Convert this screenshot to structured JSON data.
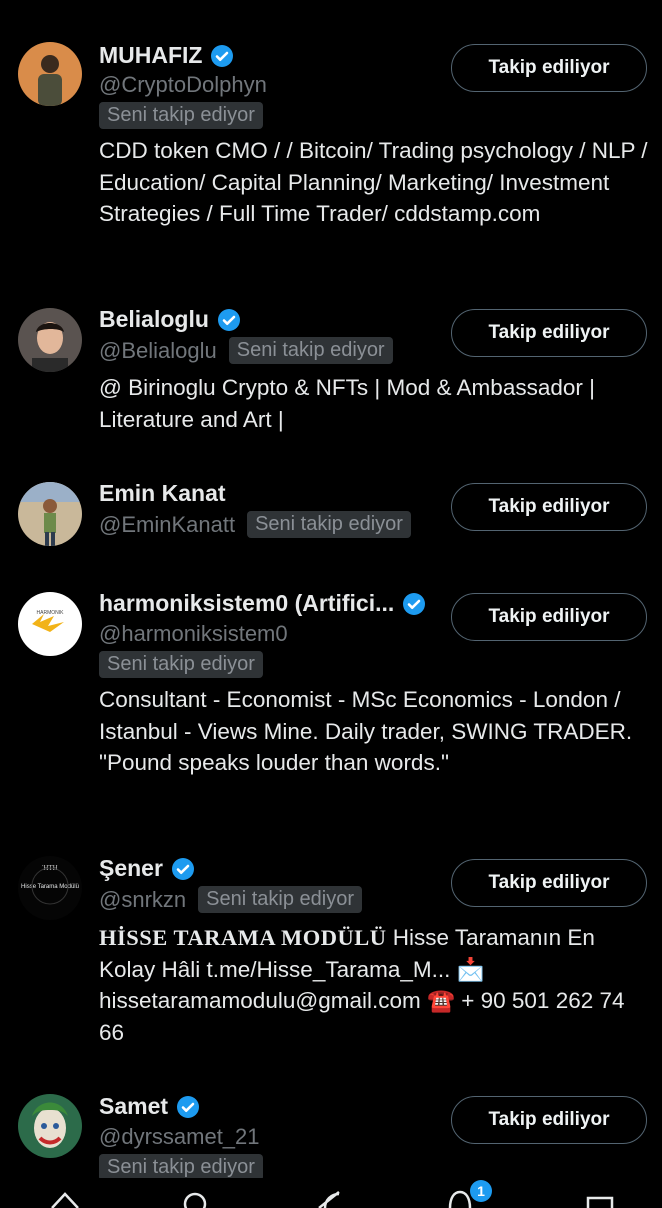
{
  "colors": {
    "background": "#000000",
    "verified": "#1d9bf0",
    "badge_bg": "#2f3336"
  },
  "users": [
    {
      "name": "MUHAFIZ",
      "handle": "@CryptoDolphyn",
      "follows_you": "Seni takip ediyor",
      "bio": "CDD token CMO / / Bitcoin/ Trading psychology / NLP / Education/ Capital Planning/ Marketing/ Investment Strategies / Full Time Trader/ cddstamp.com",
      "button": "Takip ediliyor",
      "verified": true
    },
    {
      "name": "Belialoglu",
      "handle": "@Belialoglu",
      "follows_you": "Seni takip ediyor",
      "bio": "@ Birinoglu Crypto & NFTs | Mod & Ambassador | Literature and Art |",
      "button": "Takip ediliyor",
      "verified": true
    },
    {
      "name": "Emin Kanat",
      "handle": "@EminKanatt",
      "follows_you": "Seni takip ediyor",
      "bio": "",
      "button": "Takip ediliyor",
      "verified": false
    },
    {
      "name": "harmoniksistem0 (Artifici...",
      "handle": "@harmoniksistem0",
      "follows_you": "Seni takip ediyor",
      "bio": "Consultant - Economist - MSc Economics - London / Istanbul - Views Mine. Daily trader, SWING TRADER. \"Pound speaks louder than words.\"",
      "button": "Takip ediliyor",
      "verified": true,
      "avatar_text": "HARMONIK"
    },
    {
      "name": "Şener",
      "handle": "@snrkzn",
      "follows_you": "Seni takip ediyor",
      "bio_bold": "HİSSE TARAMA MODÜLÜ",
      "bio": " Hisse Taramanın En Kolay Hâli t.me/Hisse_Tarama_M... 📩 hissetaramamodulu@gmail.com ☎️ + 90 501 262 74 66",
      "button": "Takip ediliyor",
      "verified": true,
      "avatar_text": "Hisse Tarama Modülü"
    },
    {
      "name": "Samet",
      "handle": "@dyrssamet_21",
      "follows_you": "Seni takip ediyor",
      "button": "Takip ediliyor",
      "verified": true
    }
  ],
  "bottom_nav": {
    "icons": [
      "home-icon",
      "search-icon",
      "grok-icon",
      "notifications-icon",
      "messages-icon"
    ],
    "notification_count": "1"
  }
}
